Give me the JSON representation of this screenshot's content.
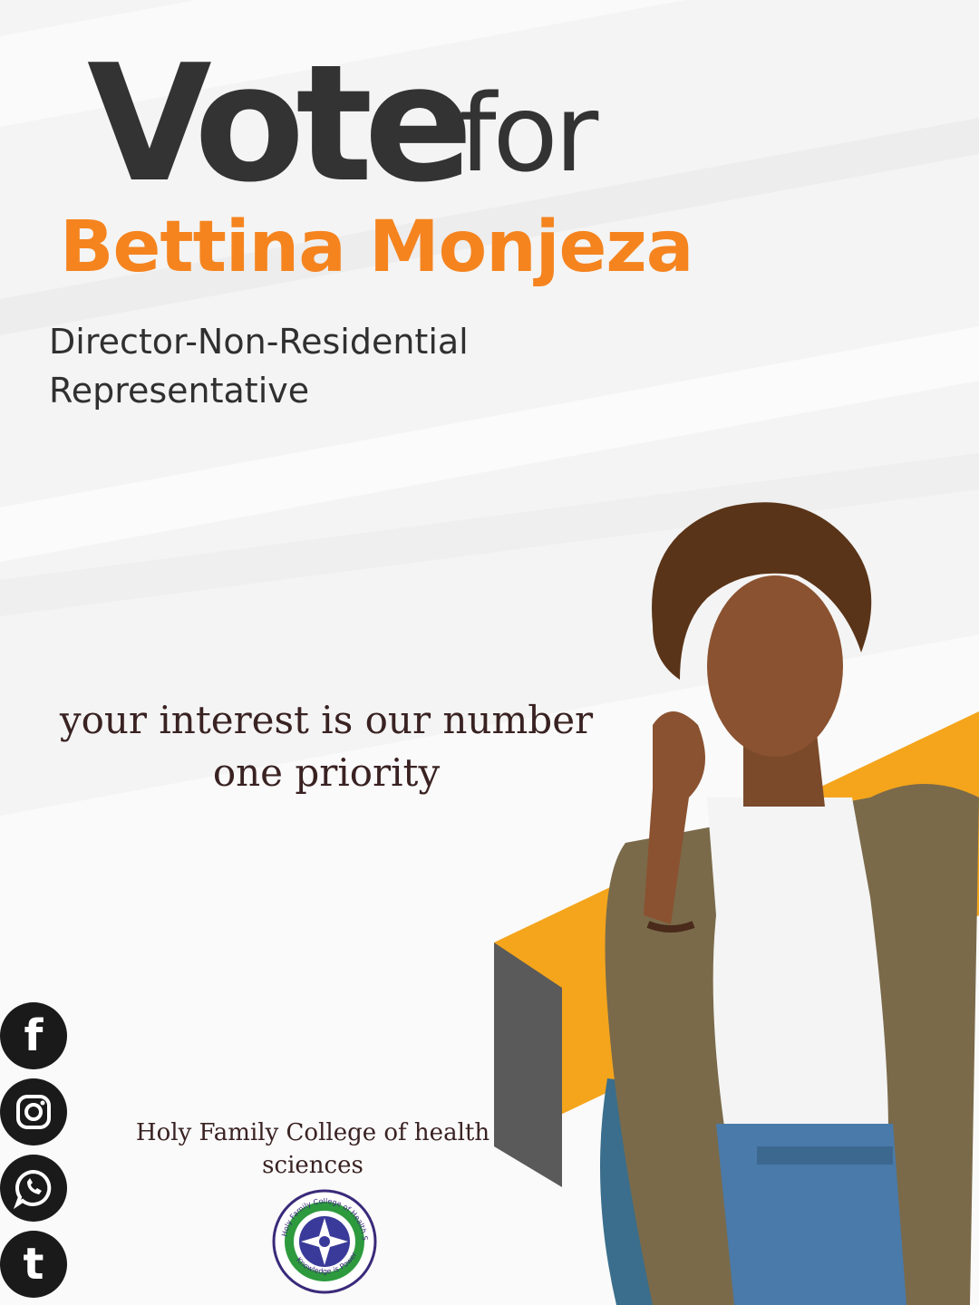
{
  "headline": {
    "vote": "Vote",
    "for": "for"
  },
  "candidate": {
    "name": "Bettina Monjeza",
    "position_line1": "Director-Non-Residential",
    "position_line2": "Representative",
    "photo_description": "candidate-portrait"
  },
  "slogan": {
    "line1": "your interest is our number",
    "line2": "one priority"
  },
  "college": {
    "name_line1": "Holy Family College of health",
    "name_line2": "sciences",
    "seal_text": "Holy Family College of Health Sciences",
    "seal_motto": "Knowledge is Power"
  },
  "social": [
    {
      "icon": "facebook-icon",
      "glyph": "f"
    },
    {
      "icon": "instagram-icon",
      "glyph": ""
    },
    {
      "icon": "whatsapp-icon",
      "glyph": ""
    },
    {
      "icon": "tumblr-icon",
      "glyph": "t"
    }
  ],
  "colors": {
    "accent_orange": "#f5841f",
    "stripe_yellow": "#f4a51c",
    "stripe_gray": "#5a5a5a",
    "text_dark": "#333333",
    "icon_dark": "#1a1a1a"
  }
}
